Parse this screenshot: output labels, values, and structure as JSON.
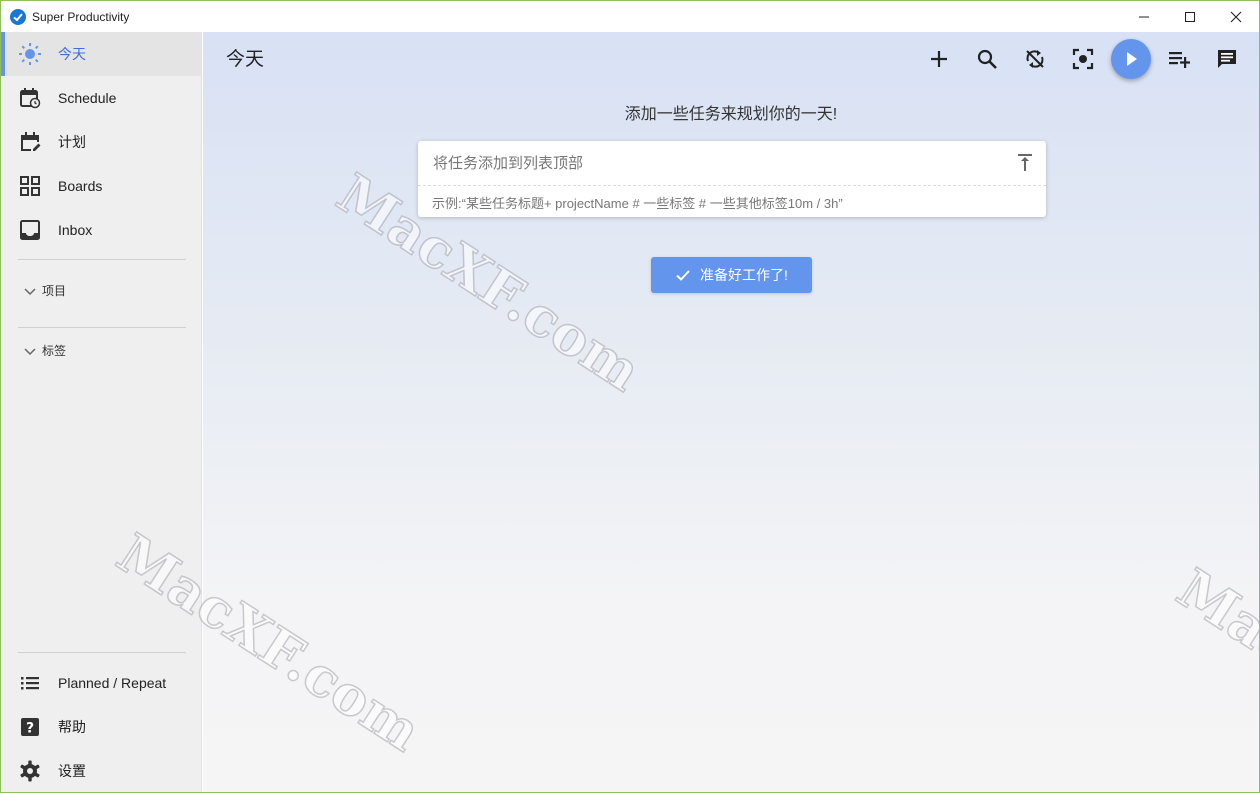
{
  "window": {
    "title": "Super Productivity",
    "controls": {
      "minimize": "minimize-icon",
      "maximize": "maximize-icon",
      "close": "close-icon"
    }
  },
  "sidebar": {
    "items": [
      {
        "label": "今天",
        "icon": "sun-icon",
        "active": true
      },
      {
        "label": "Schedule",
        "icon": "calendar-clock-icon"
      },
      {
        "label": "计划",
        "icon": "calendar-edit-icon"
      },
      {
        "label": "Boards",
        "icon": "grid-icon"
      },
      {
        "label": "Inbox",
        "icon": "inbox-icon"
      }
    ],
    "groups": [
      {
        "label": "项目"
      },
      {
        "label": "标签"
      }
    ],
    "bottom_items": [
      {
        "label": "Planned / Repeat",
        "icon": "list-icon"
      },
      {
        "label": "帮助",
        "icon": "help-icon"
      },
      {
        "label": "设置",
        "icon": "gear-icon"
      }
    ]
  },
  "main": {
    "title": "今天",
    "toolbar": [
      "add-icon",
      "search-icon",
      "sync-off-icon",
      "focus-icon",
      "play-icon",
      "playlist-add-icon",
      "comment-icon"
    ],
    "empty_message": "添加一些任务来规划你的一天!",
    "add_task": {
      "placeholder": "将任务添加到列表顶部",
      "hint": "示例:“某些任务标题+ projectName # 一些标签 # 一些其他标签10m / 3h”"
    },
    "ready_button": "准备好工作了!"
  },
  "watermark": "MacXF.com",
  "colors": {
    "accent": "#6495ed",
    "sidebar_bg": "#efefef"
  }
}
